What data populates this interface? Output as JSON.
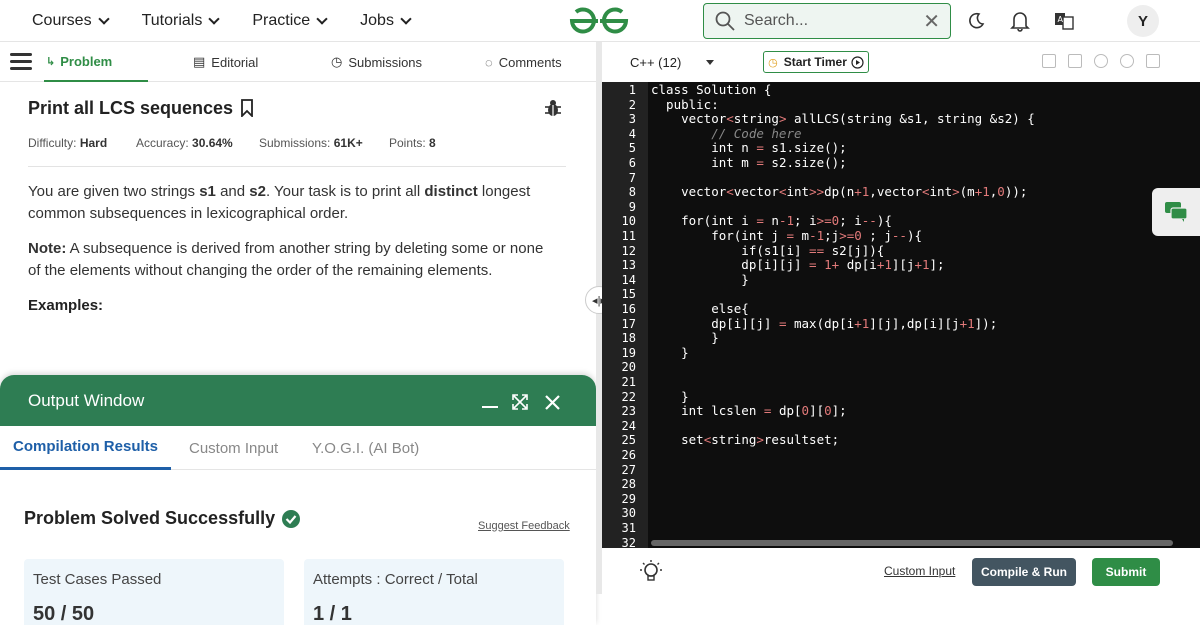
{
  "header": {
    "nav": [
      "Courses",
      "Tutorials",
      "Practice",
      "Jobs"
    ],
    "search_placeholder": "Search...",
    "avatar_initial": "Y"
  },
  "problem_tabs": [
    "Problem",
    "Editorial",
    "Submissions",
    "Comments"
  ],
  "problem": {
    "title": "Print all LCS sequences",
    "difficulty_label": "Difficulty:",
    "difficulty": "Hard",
    "accuracy_label": "Accuracy:",
    "accuracy": "30.64%",
    "submissions_label": "Submissions:",
    "submissions": "61K+",
    "points_label": "Points:",
    "points": "8",
    "desc_1": "You are given two strings ",
    "desc_s1": "s1",
    "desc_and": " and ",
    "desc_s2": "s2",
    "desc_2": ". Your task is to print all ",
    "desc_distinct": "distinct",
    "desc_3": " longest common subsequences in lexicographical order.",
    "note_label": "Note:",
    "note_text": " A subsequence is derived from another string by deleting some or none of the elements without changing the order of the remaining elements.",
    "examples": "Examples:"
  },
  "output_window": {
    "title": "Output Window",
    "tabs": [
      "Compilation Results",
      "Custom Input",
      "Y.O.G.I. (AI Bot)"
    ],
    "status": "Problem Solved Successfully",
    "feedback": "Suggest Feedback",
    "card1_label": "Test Cases Passed",
    "card1_value": "50 / 50",
    "card2_label": "Attempts : Correct / Total",
    "card2_value": "1 / 1"
  },
  "editor": {
    "language": "C++ (12)",
    "timer": "Start Timer",
    "lines": [
      "class Solution {",
      "  public:",
      "    vector<string> allLCS(string &s1, string &s2) {",
      "        // Code here",
      "        int n = s1.size();",
      "        int m = s2.size();",
      "",
      "    vector<vector<int>>dp(n+1,vector<int>(m+1,0));",
      "",
      "    for(int i = n-1; i>=0; i--){",
      "        for(int j = m-1;j>=0 ; j--){",
      "            if(s1[i] == s2[j]){",
      "            dp[i][j] = 1+ dp[i+1][j+1];",
      "            }",
      "",
      "        else{",
      "        dp[i][j] = max(dp[i+1][j],dp[i][j+1]);",
      "        }",
      "    }",
      "",
      "",
      "    }",
      "    int lcslen = dp[0][0];",
      "",
      "    set<string>resultset;",
      "",
      "",
      "",
      "",
      "",
      "",
      ""
    ],
    "custom_input": "Custom Input",
    "compile_run": "Compile & Run",
    "submit": "Submit"
  }
}
